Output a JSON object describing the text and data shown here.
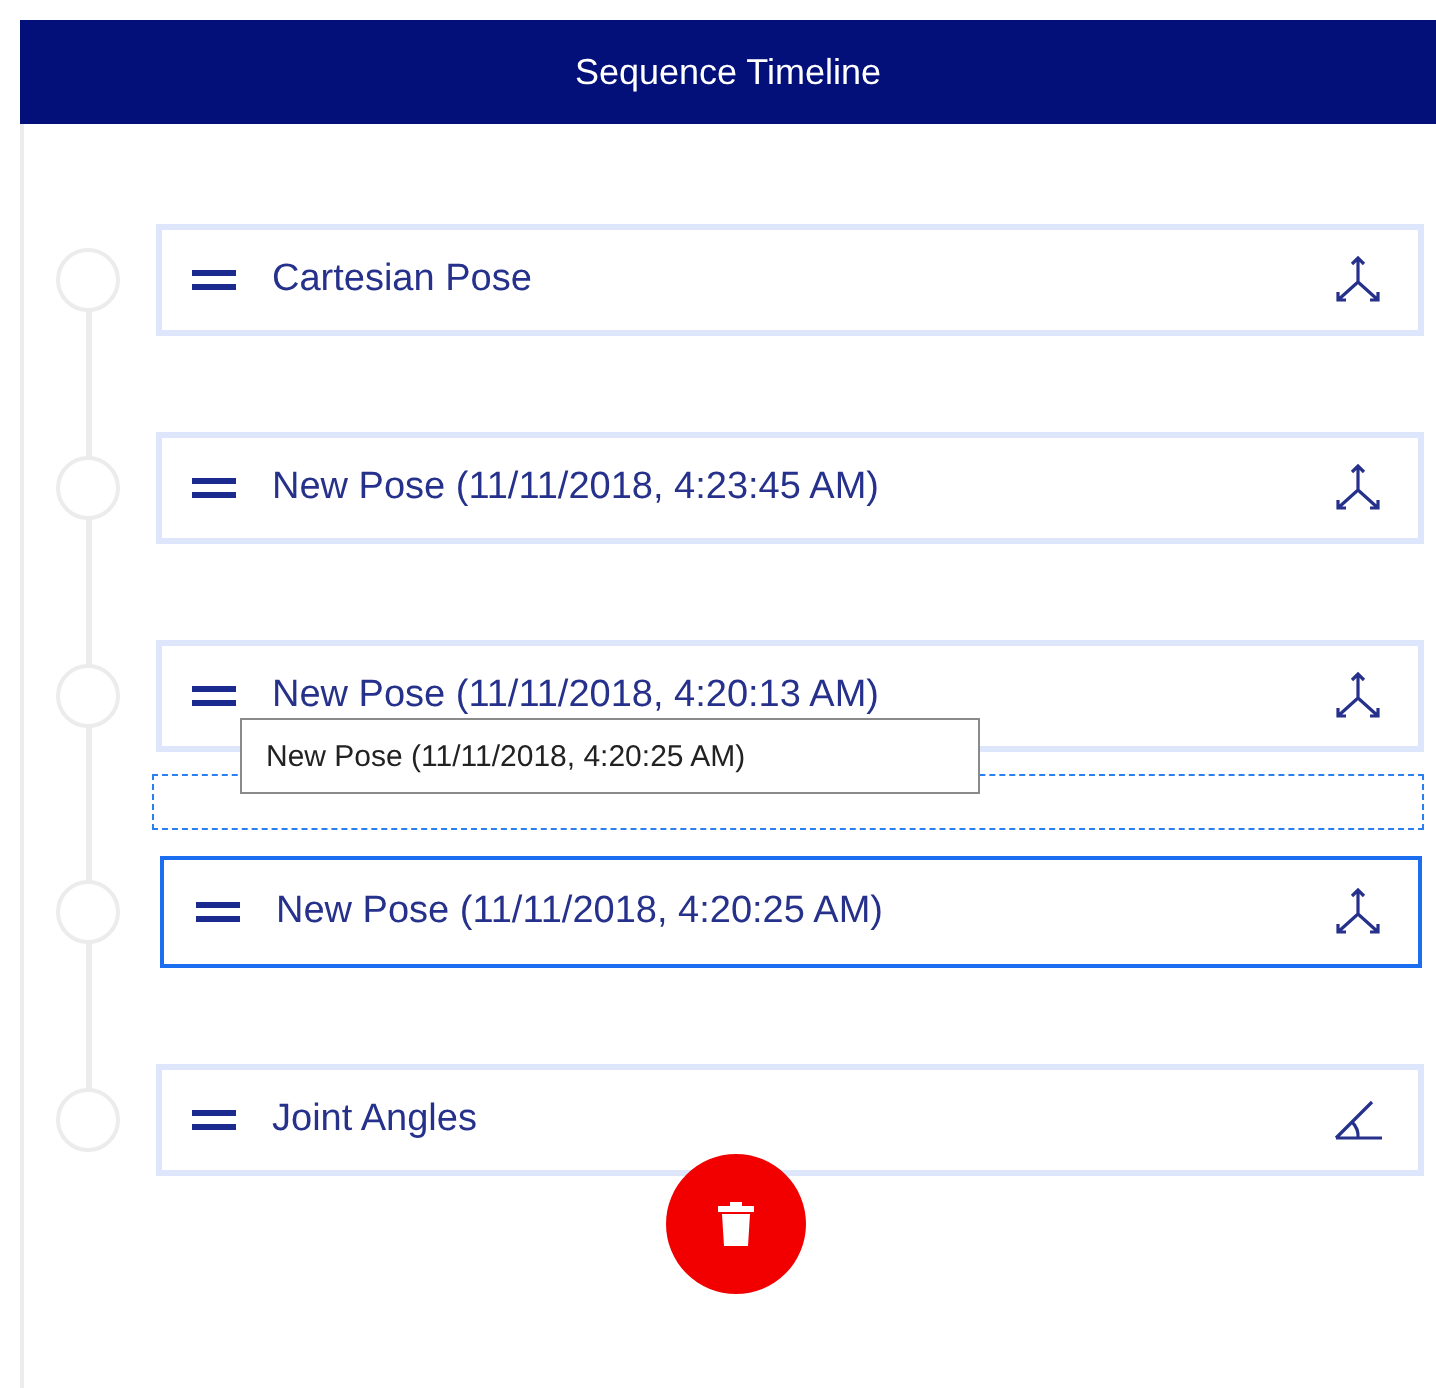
{
  "header": {
    "title": "Sequence Timeline"
  },
  "items": [
    {
      "kind": "pose",
      "label": "Cartesian Pose",
      "selected": false
    },
    {
      "kind": "pose",
      "label": "New Pose (11/11/2018, 4:23:45 AM)",
      "selected": false
    },
    {
      "kind": "pose",
      "label": "New Pose (11/11/2018, 4:20:13 AM)",
      "selected": false
    },
    {
      "kind": "drop_target"
    },
    {
      "kind": "pose",
      "label": "New Pose (11/11/2018, 4:20:25 AM)",
      "selected": true
    },
    {
      "kind": "joint",
      "label": "Joint Angles",
      "selected": false
    }
  ],
  "drag_preview": {
    "label": "New Pose (11/11/2018, 4:20:25 AM)"
  },
  "delete_button": {
    "kind": "trash"
  }
}
